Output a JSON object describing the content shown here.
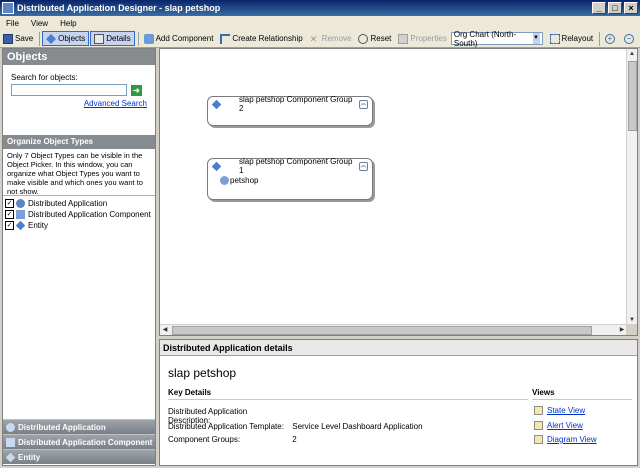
{
  "window": {
    "title": "Distributed Application Designer - slap petshop"
  },
  "menu": [
    "File",
    "View",
    "Help"
  ],
  "toolbar": {
    "save": "Save",
    "objects": "Objects",
    "details": "Details",
    "add_component": "Add Component",
    "create_relationship": "Create Relationship",
    "remove": "Remove",
    "reset": "Reset",
    "properties": "Properties",
    "layout_select": "Org Chart (North-South)",
    "relayout": "Relayout"
  },
  "left": {
    "header": "Objects",
    "search_label": "Search for objects:",
    "search_value": "",
    "advanced_search": "Advanced Search",
    "organize_header": "Organize Object Types",
    "organize_text": "Only 7 Object Types can be visible in the Object Picker. In this window, you can organize what Object Types you want to make visible and which ones you want to not show.",
    "types": [
      {
        "label": "Distributed Application",
        "checked": true
      },
      {
        "label": "Distributed Application Component",
        "checked": true
      },
      {
        "label": "Entity",
        "checked": true
      }
    ],
    "wunderbar": [
      "Distributed Application",
      "Distributed Application Component",
      "Entity"
    ]
  },
  "canvas": {
    "groups": [
      {
        "title": "slap petshop Component Group 2",
        "members": []
      },
      {
        "title": "slap petshop Component Group 1",
        "members": [
          "petshop"
        ]
      }
    ]
  },
  "details": {
    "header": "Distributed Application details",
    "app_name": "slap petshop",
    "key_details_label": "Key Details",
    "rows": [
      {
        "key": "Distributed Application Description:",
        "value": ""
      },
      {
        "key": "Distributed Application Template:",
        "value": "Service Level Dashboard Application"
      },
      {
        "key": "Component Groups:",
        "value": "2"
      }
    ],
    "views_label": "Views",
    "views": [
      "State View",
      "Alert View",
      "Diagram View"
    ]
  },
  "colors": {
    "title_bar": "#0a246a",
    "pane_header": "#868b8f",
    "link": "#0033cc"
  }
}
